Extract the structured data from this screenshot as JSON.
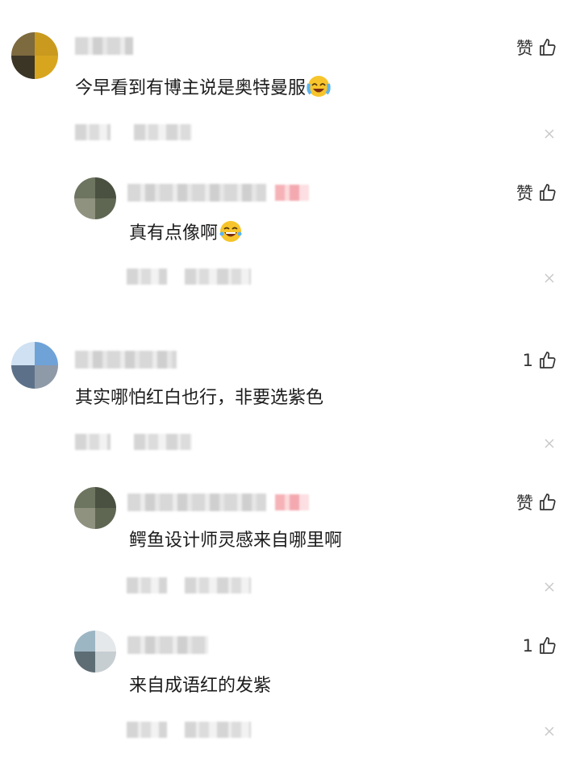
{
  "colors": {
    "text": "#1c1c1c",
    "meta_gray": "#c8c8c8",
    "tag_pink": "#f5b3b8",
    "icon": "#333333"
  },
  "comments": [
    {
      "text": "今早看到有博主说是奥特曼服",
      "emoji": "crying-laughing-face",
      "like_label": "赞",
      "reply": false
    },
    {
      "text": "真有点像啊",
      "emoji": "laughing-face",
      "like_label": "赞",
      "reply": true
    },
    {
      "text": "其实哪怕红白也行，非要选紫色",
      "emoji": null,
      "like_label": "1",
      "reply": false
    },
    {
      "text": "鳄鱼设计师灵感来自哪里啊",
      "emoji": null,
      "like_label": "赞",
      "reply": true
    },
    {
      "text": "来自成语红的发紫",
      "emoji": null,
      "like_label": "1",
      "reply": true
    }
  ],
  "icons": {
    "like": "thumbs-up-icon",
    "dismiss": "close-icon"
  }
}
